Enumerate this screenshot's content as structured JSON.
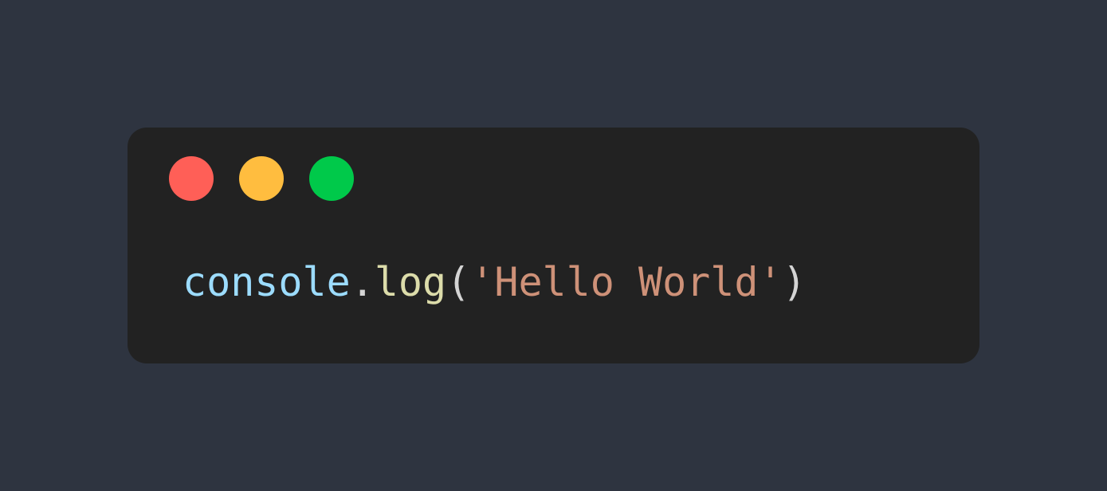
{
  "colors": {
    "page_background": "#2e3440",
    "window_background": "#222222",
    "close_dot": "#ff5f57",
    "minimize_dot": "#ffbd3f",
    "maximize_dot": "#00c94a",
    "identifier": "#9cdcfe",
    "punctuation": "#d4d4d4",
    "method": "#dcdcaa",
    "string": "#ce9178"
  },
  "window_controls": {
    "close": "close-dot",
    "minimize": "minimize-dot",
    "maximize": "maximize-dot"
  },
  "code": {
    "object": "console",
    "dot": ".",
    "method": "log",
    "open_paren": "(",
    "string": "'Hello World'",
    "close_paren": ")"
  }
}
